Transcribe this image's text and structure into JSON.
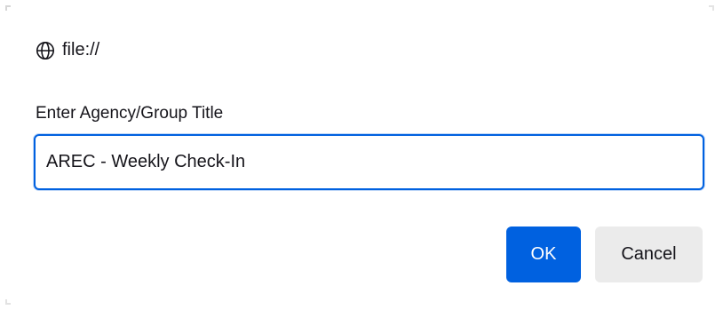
{
  "dialog": {
    "origin": {
      "icon": "globe-icon",
      "text": "file://"
    },
    "prompt_label": "Enter Agency/Group Title",
    "input": {
      "value": "AREC - Weekly Check-In",
      "placeholder": ""
    },
    "buttons": {
      "ok_label": "OK",
      "cancel_label": "Cancel"
    }
  },
  "colors": {
    "accent": "#0061e0",
    "cancel_bg": "#ebebeb",
    "text": "#15141a"
  }
}
